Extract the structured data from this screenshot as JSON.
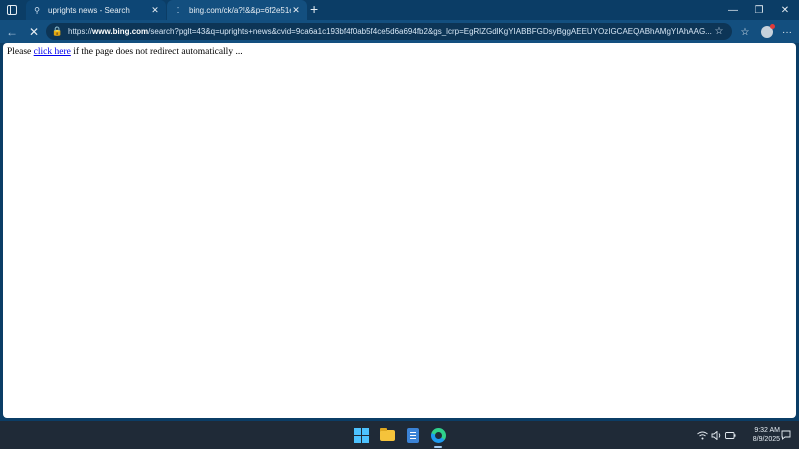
{
  "browser": {
    "tabs": [
      {
        "title": "uprights news - Search",
        "icon": "search-icon",
        "active": false
      },
      {
        "title": "bing.com/ck/a?!&&p=6f2e51e1e",
        "icon": "loading-icon",
        "active": true
      }
    ],
    "new_tab_symbol": "+",
    "window_controls": {
      "minimize": "—",
      "maximize": "❐",
      "close": "✕"
    },
    "address": {
      "scheme": "https://",
      "host": "www.bing.com",
      "path": "/search?pglt=43&q=uprights+news&cvid=9ca6a1c193bf4f0ab5f4ce5d6a694fb2&gs_lcrp=EgRlZGdlKgYIABBFGDsyBggAEEUYOzIGCAEQABhAMgYIAhAAG..."
    },
    "toolbar_icons": [
      "back-icon",
      "stop-loading-icon",
      "lock-icon",
      "favorite-star-icon",
      "collections-icon",
      "profile-avatar",
      "more-icon"
    ]
  },
  "page": {
    "before_link": "Please ",
    "link_text": "click here",
    "after_link": " if the page does not redirect automatically ..."
  },
  "taskbar": {
    "apps": [
      "start-icon",
      "file-explorer-icon",
      "notepad-icon",
      "edge-icon"
    ],
    "time": "9:32 AM",
    "date": "8/9/2025"
  },
  "colors": {
    "frame": "#0b3d66",
    "toolbar": "#134f7f",
    "taskbar": "#1f2a37",
    "link": "#0000ee"
  }
}
